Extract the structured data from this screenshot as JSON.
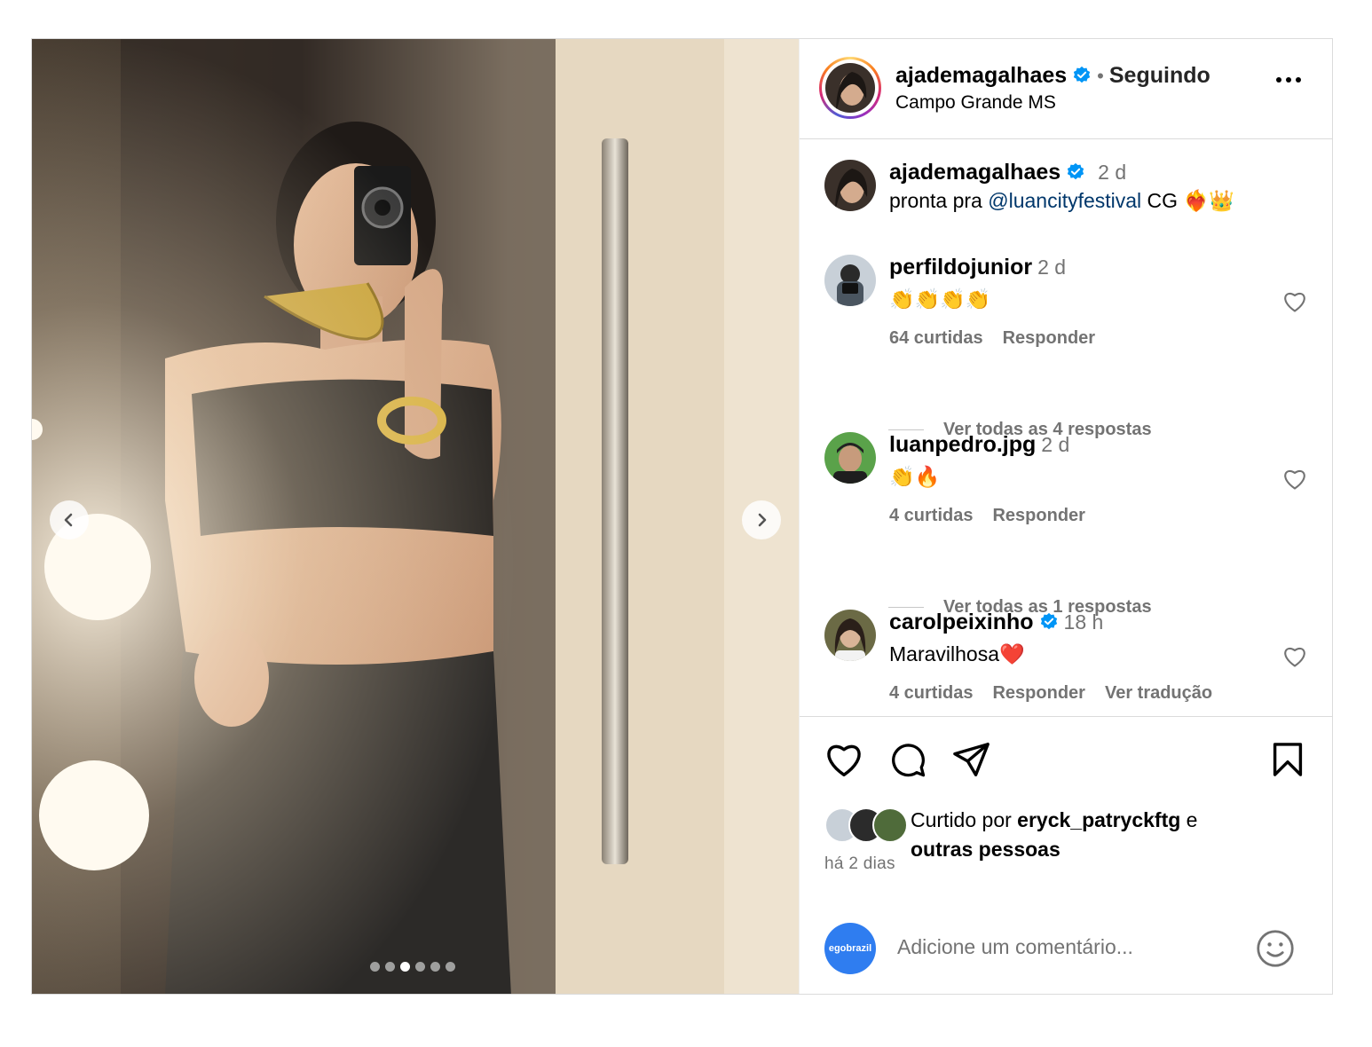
{
  "post": {
    "author": "ajademagalhaes",
    "follow_label": "Seguindo",
    "separator": "•",
    "location": "Campo Grande MS",
    "caption": {
      "username": "ajademagalhaes",
      "time": "2 d",
      "text_before": "pronta pra ",
      "mention": "@luancityfestival",
      "text_after": " CG ❤️‍🔥👑"
    }
  },
  "carousel": {
    "slide_count": 6,
    "active_index": 2
  },
  "comments": [
    {
      "username": "perfildojunior",
      "time": "2 d",
      "text": "👏👏👏👏",
      "likes": "64 curtidas",
      "reply": "Responder",
      "view_replies": "Ver todas as 4 respostas"
    },
    {
      "username": "luanpedro.jpg",
      "time": "2 d",
      "text": "👏🔥",
      "likes": "4 curtidas",
      "reply": "Responder",
      "view_replies": "Ver todas as 1 respostas"
    },
    {
      "username": "carolpeixinho",
      "time": "18 h",
      "text": "Maravilhosa❤️",
      "likes": "4 curtidas",
      "reply": "Responder",
      "translate": "Ver tradução",
      "verified": true
    }
  ],
  "liked_by": {
    "prefix": "Curtido por ",
    "user": "eryck_patryckftg",
    "middle": " e",
    "others": "outras pessoas"
  },
  "posted_ago": "há 2 dias",
  "add_comment": {
    "avatar_label": "egobrazil",
    "placeholder": "Adicione um comentário..."
  },
  "icons": {
    "more": "more-options-icon",
    "like": "heart-icon",
    "comment": "comment-icon",
    "share": "share-icon",
    "save": "bookmark-icon",
    "emoji": "emoji-icon",
    "prev": "chevron-left-icon",
    "next": "chevron-right-icon",
    "verified": "verified-badge-icon"
  },
  "colors": {
    "verified": "#0095f6",
    "muted": "#737373",
    "mention": "#00376b",
    "border": "#dbdbdb"
  }
}
